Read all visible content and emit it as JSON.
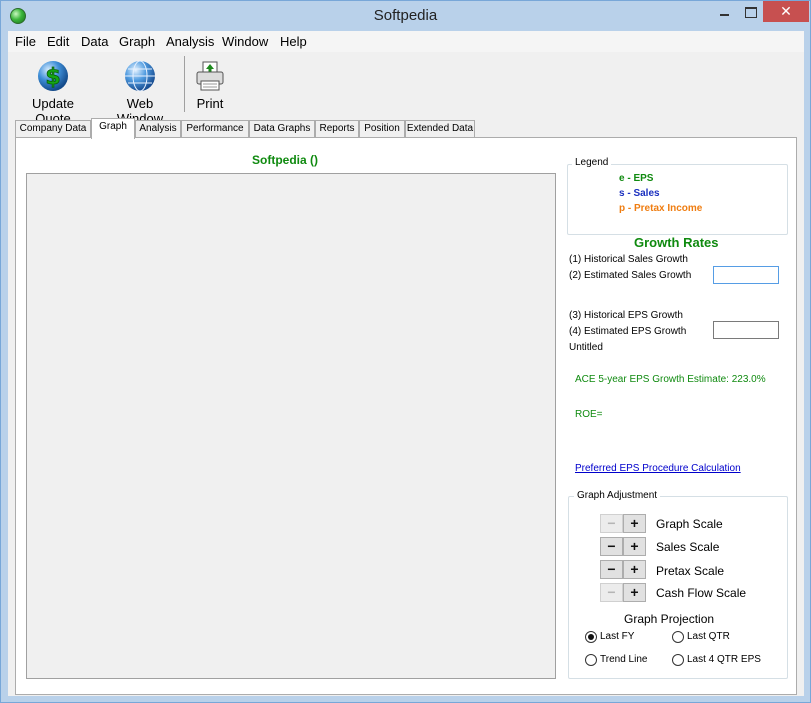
{
  "window": {
    "title": "Softpedia"
  },
  "menu": [
    "File",
    "Edit",
    "Data",
    "Graph",
    "Analysis",
    "Window",
    "Help"
  ],
  "toolbar": {
    "update_quote": "Update Quote",
    "web_window": "Web Window",
    "print": "Print"
  },
  "tabs": [
    "Company Data",
    "Graph",
    "Analysis",
    "Performance",
    "Data Graphs",
    "Reports",
    "Position",
    "Extended Data"
  ],
  "active_tab": "Graph",
  "graph": {
    "title": "Softpedia  ()"
  },
  "legend": {
    "title": "Legend",
    "items": [
      {
        "label": "e - EPS",
        "color": "#0f8a0f"
      },
      {
        "label": "s - Sales",
        "color": "#1a2fbf"
      },
      {
        "label": "p - Pretax Income",
        "color": "#ef7d11"
      }
    ]
  },
  "growth": {
    "title": "Growth Rates",
    "hist_sales": "(1) Historical Sales Growth",
    "est_sales": "(2) Estimated Sales Growth",
    "est_sales_value": "",
    "hist_eps": "(3) Historical EPS Growth",
    "est_eps": "(4) Estimated EPS Growth",
    "est_eps_value": "",
    "untitled": "Untitled",
    "ace_estimate": "ACE 5-year EPS Growth Estimate: 223.0%",
    "roe": "ROE=",
    "link": "Preferred EPS Procedure Calculation"
  },
  "adjust": {
    "title": "Graph Adjustment",
    "scales": [
      {
        "label": "Graph Scale",
        "minus_enabled": false
      },
      {
        "label": "Sales Scale",
        "minus_enabled": true
      },
      {
        "label": "Pretax Scale",
        "minus_enabled": true
      },
      {
        "label": "Cash Flow Scale",
        "minus_enabled": false
      }
    ],
    "projection_title": "Graph Projection",
    "options": [
      "Last FY",
      "Last QTR",
      "Trend Line",
      "Last 4 QTR EPS"
    ],
    "selected": "Last FY"
  }
}
